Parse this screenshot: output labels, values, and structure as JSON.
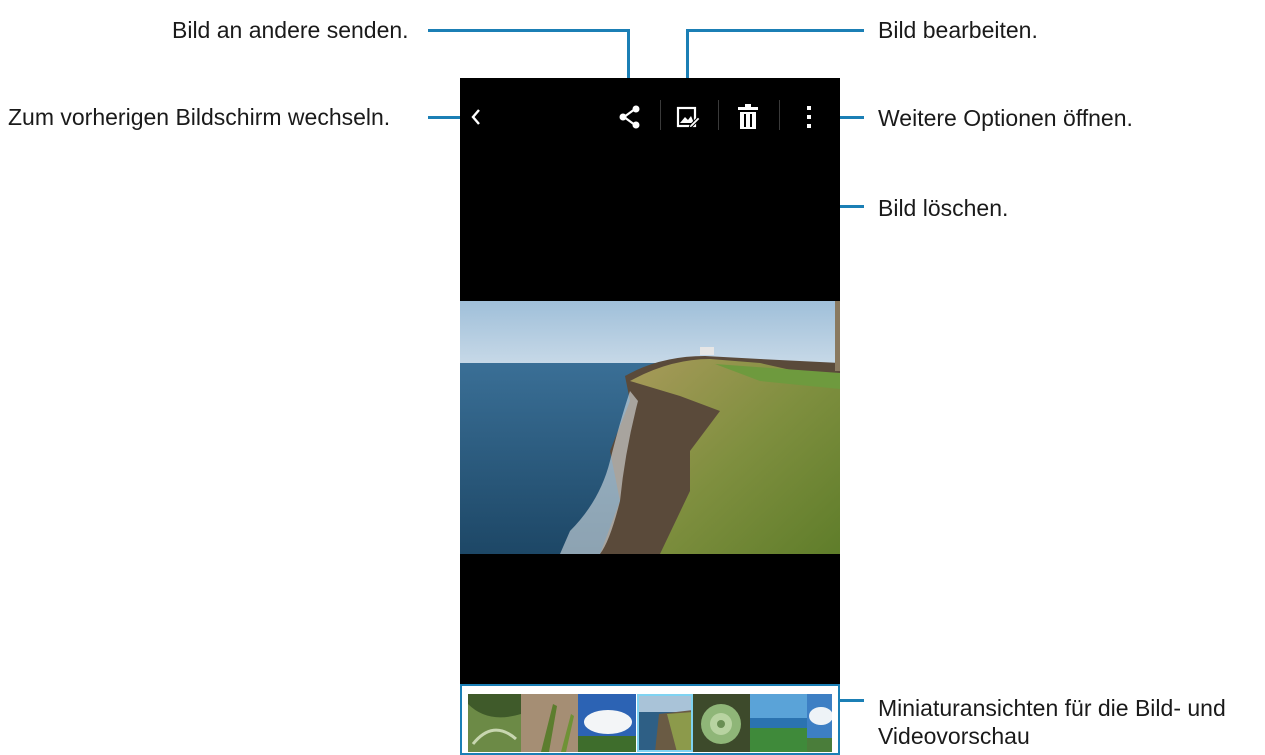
{
  "annotations": {
    "share": "Bild an andere senden.",
    "back": "Zum vorherigen Bildschirm wechseln.",
    "edit": "Bild bearbeiten.",
    "more": "Weitere Optionen öffnen.",
    "delete": "Bild löschen.",
    "thumbnails_line1": "Miniaturansichten für die Bild- und",
    "thumbnails_line2": "Videovorschau"
  },
  "toolbar": {
    "back_icon": "chevron-left-icon",
    "share_icon": "share-icon",
    "edit_icon": "edit-image-icon",
    "delete_icon": "trash-icon",
    "more_icon": "more-vertical-icon"
  },
  "colors": {
    "callout_line": "#1b7fb5",
    "screen_bg": "#000000",
    "selected_thumb": "#7fd3f2"
  },
  "thumbnails": {
    "count": 7,
    "selected_index": 3
  }
}
